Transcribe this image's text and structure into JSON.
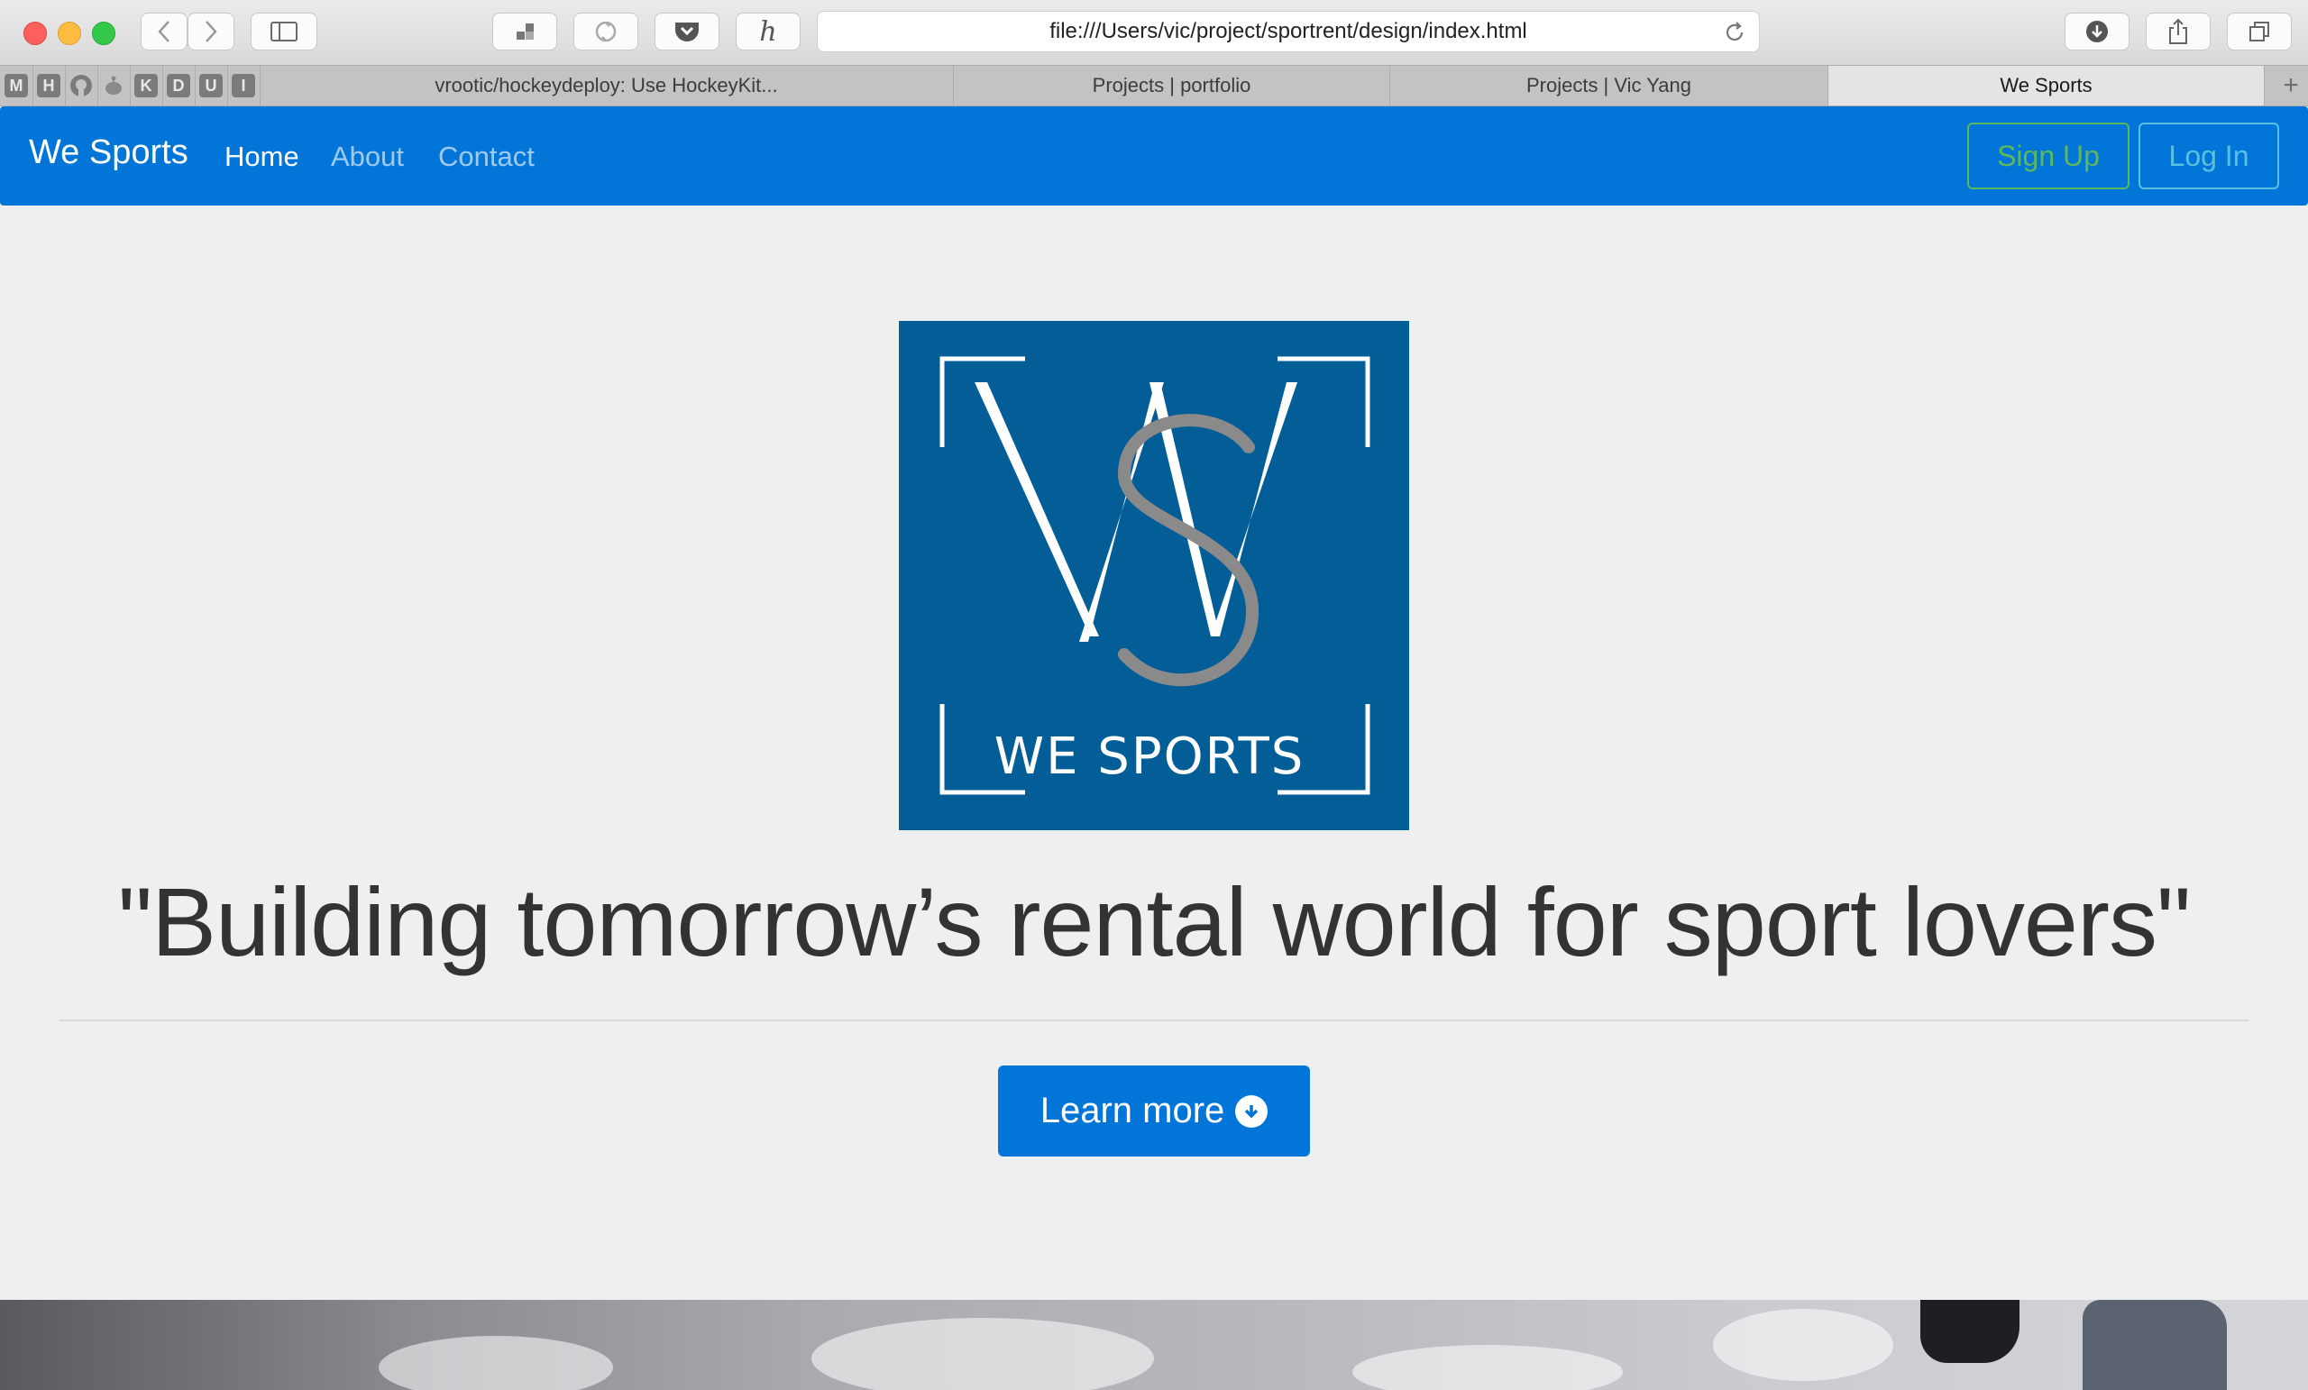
{
  "browser": {
    "url": "file:///Users/vic/project/sportrent/design/index.html",
    "pinned_tabs": [
      "M",
      "H",
      "",
      "",
      "K",
      "D",
      "U",
      "I"
    ],
    "tabs": [
      {
        "label": "vrootic/hockeydeploy: Use HockeyKit..."
      },
      {
        "label": "Projects | portfolio"
      },
      {
        "label": "Projects | Vic Yang"
      },
      {
        "label": "We Sports",
        "active": true
      }
    ]
  },
  "navbar": {
    "brand": "We Sports",
    "links": [
      {
        "label": "Home",
        "active": true
      },
      {
        "label": "About"
      },
      {
        "label": "Contact"
      }
    ],
    "signup_label": "Sign Up",
    "login_label": "Log In",
    "bg_color": "#0275d8"
  },
  "hero": {
    "logo_text": "WE SPORTS",
    "tagline": "\"Building tomorrow’s rental world for sport lovers\"",
    "cta_label": "Learn more",
    "cta_icon": "arrow-circle-down-icon"
  },
  "colors": {
    "primary": "#0275d8",
    "success": "#5cb85c",
    "info": "#5bc0de",
    "logo_bg": "#035e98"
  }
}
